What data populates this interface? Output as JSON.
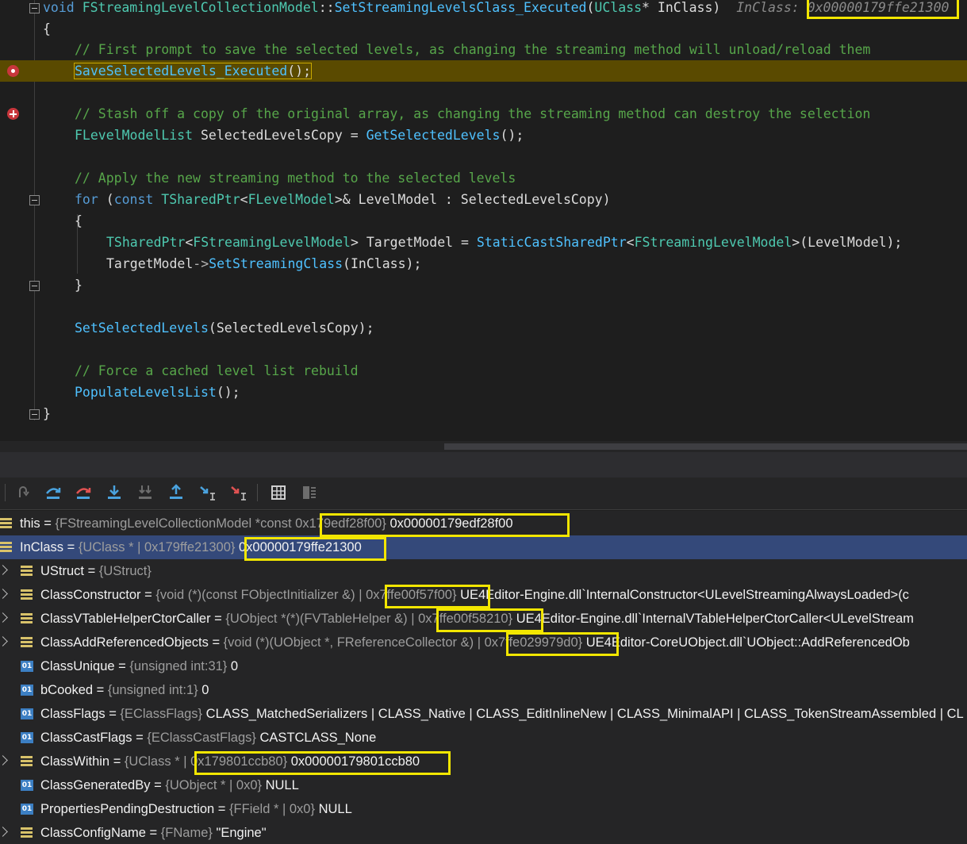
{
  "editor": {
    "lines": {
      "l1": {
        "kw": "void",
        "cls": "FStreamingLevelCollectionModel",
        "sep": "::",
        "fn": "SetStreamingLevelsClass_Executed",
        "open": "(",
        "ptype": "UClass",
        "rest": "* InClass)",
        "hint_label": "InClass:",
        "hint_value": "0x00000179ffe21300"
      },
      "l2": "{",
      "l3": "// First prompt to save the selected levels, as changing the streaming method will unload/reload them",
      "l4": {
        "fn": "SaveSelectedLevels_Executed",
        "rest": "();"
      },
      "l5": "// Stash off a copy of the original array, as changing the streaming method can destroy the selection",
      "l6": {
        "type": "FLevelModelList",
        "mid": " SelectedLevelsCopy = ",
        "fn": "GetSelectedLevels",
        "rest": "();"
      },
      "l7": "// Apply the new streaming method to the selected levels",
      "l8": {
        "kw1": "for",
        "p1": " (",
        "kw2": "const",
        "sp": " ",
        "t1": "TSharedPtr",
        "lt": "<",
        "t2": "FLevelModel",
        "rest": ">& LevelModel : SelectedLevelsCopy)"
      },
      "l9": "{",
      "l10": {
        "t1": "TSharedPtr",
        "lt": "<",
        "t2": "FStreamingLevelModel",
        "mid": "> TargetModel = ",
        "fn": "StaticCastSharedPtr",
        "lt2": "<",
        "t3": "FStreamingLevelModel",
        "rest": ">(LevelModel);"
      },
      "l11": {
        "obj": "TargetModel",
        "arrow": "->",
        "fn": "SetStreamingClass",
        "rest": "(InClass);"
      },
      "l12": "}",
      "l13": {
        "fn": "SetSelectedLevels",
        "rest": "(SelectedLevelsCopy);"
      },
      "l14": "// Force a cached level list rebuild",
      "l15": {
        "fn": "PopulateLevelsList",
        "rest": "();"
      },
      "l16": "}"
    }
  },
  "toolbar": {
    "icons": [
      "show-next-statement-icon",
      "step-over-icon",
      "step-over-disabled-icon",
      "step-into-icon",
      "step-into-specific-icon",
      "step-out-icon",
      "run-to-cursor-icon",
      "run-to-cursor-disabled-icon",
      "memory-view-icon",
      "registers-view-icon"
    ]
  },
  "variables": [
    {
      "name": "this",
      "type": "{FStreamingLevelCollectionModel *const",
      "addr": "0x179edf28f00}",
      "value": "0x00000179edf28f00",
      "expandable": false,
      "icon": "struct"
    },
    {
      "name": "InClass",
      "type": "{UClass * | 0x179ffe21300}",
      "addr": "",
      "value": "0x00000179ffe21300",
      "expandable": false,
      "icon": "struct",
      "selected": true
    },
    {
      "name": "UStruct",
      "type": "{UStruct}",
      "addr": "",
      "value": "",
      "expandable": true,
      "icon": "struct"
    },
    {
      "name": "ClassConstructor",
      "type": "{void (*)(const FObjectInitializer &) |",
      "addr": "0x7ffe00f57f00}",
      "value": "UE4Editor-Engine.dll`InternalConstructor<ULevelStreamingAlwaysLoaded>(c",
      "expandable": true,
      "icon": "struct"
    },
    {
      "name": "ClassVTableHelperCtorCaller",
      "type": "{UObject *(*)(FVTableHelper &) |",
      "addr": "0x7ffe00f58210}",
      "value": "UE4Editor-Engine.dll`InternalVTableHelperCtorCaller<ULevelStream",
      "expandable": true,
      "icon": "struct"
    },
    {
      "name": "ClassAddReferencedObjects",
      "type": "{void (*)(UObject *, FReferenceCollector &) |",
      "addr": "0x7ffe029979d0}",
      "value": "UE4Editor-CoreUObject.dll`UObject::AddReferencedOb",
      "expandable": true,
      "icon": "struct"
    },
    {
      "name": "ClassUnique",
      "type": "{unsigned int:31}",
      "addr": "",
      "value": "0",
      "expandable": false,
      "icon": "01"
    },
    {
      "name": "bCooked",
      "type": "{unsigned int:1}",
      "addr": "",
      "value": "0",
      "expandable": false,
      "icon": "01"
    },
    {
      "name": "ClassFlags",
      "type": "{EClassFlags}",
      "addr": "",
      "value": "CLASS_MatchedSerializers | CLASS_Native | CLASS_EditInlineNew | CLASS_MinimalAPI | CLASS_TokenStreamAssembled | CL",
      "expandable": false,
      "icon": "01"
    },
    {
      "name": "ClassCastFlags",
      "type": "{EClassCastFlags}",
      "addr": "",
      "value": "CASTCLASS_None",
      "expandable": false,
      "icon": "01"
    },
    {
      "name": "ClassWithin",
      "type": "{UClass * |",
      "addr": "0x179801ccb80}",
      "value": "0x00000179801ccb80",
      "expandable": true,
      "icon": "struct"
    },
    {
      "name": "ClassGeneratedBy",
      "type": "{UObject * | 0x0}",
      "addr": "",
      "value": "NULL",
      "expandable": false,
      "icon": "01"
    },
    {
      "name": "PropertiesPendingDestruction",
      "type": "{FField * | 0x0}",
      "addr": "",
      "value": "NULL",
      "expandable": false,
      "icon": "01"
    },
    {
      "name": "ClassConfigName",
      "type": "{FName}",
      "addr": "",
      "value": "\"Engine\"",
      "expandable": true,
      "icon": "struct"
    }
  ],
  "colors": {
    "highlight_box": "#f2e600",
    "current_line": "#5a4a00",
    "selected_row": "#34497a"
  }
}
